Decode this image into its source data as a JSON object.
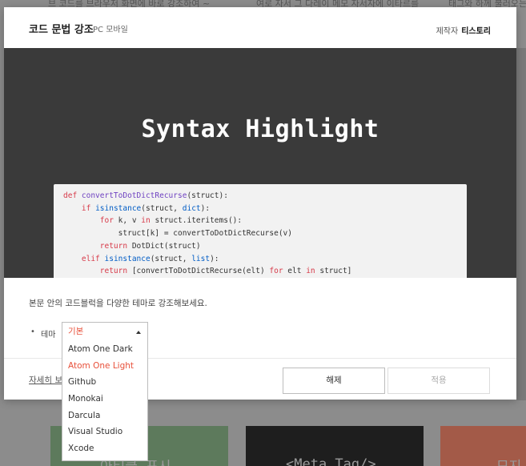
{
  "background": {
    "top_text_left": "브 코드를 브라우저 화면에 바로 강조하여 ~",
    "top_text_mid": "여로 자서 그 다레이 메모 자서자에 이타르를",
    "top_text_right": "태그와 하께 불러오는 ~",
    "card1_label": "아티클 표시",
    "card2_label": "<Meta Tag/>",
    "card3_label": "모지"
  },
  "modal": {
    "title": "코드 문법 강조",
    "subtitle": "PC 모바일",
    "maker_prefix": "제작자",
    "maker_name": "티스토리",
    "preview_title": "Syntax Highlight",
    "description": "본문 안의 코드블럭을 다양한 테마로 강조해보세요.",
    "theme_bullet": "•",
    "theme_label": "테마",
    "detail_link": "자세히 보기",
    "cancel_label": "해제",
    "apply_label": "적용"
  },
  "code": {
    "l1_kw": "def ",
    "l1_fn": "convertToDotDictRecurse",
    "l1_rest": "(struct):",
    "l2_kw": "if ",
    "l2_bi": "isinstance",
    "l2_mid": "(struct, ",
    "l2_bi2": "dict",
    "l2_rest": "):",
    "l3_kw": "for ",
    "l3_mid": "k, v ",
    "l3_kw2": "in ",
    "l3_rest": "struct.iteritems():",
    "l4": "struct[k] = convertToDotDictRecurse(v)",
    "l5_kw": "return ",
    "l5_rest": "DotDict(struct)",
    "l6_kw": "elif ",
    "l6_bi": "isinstance",
    "l6_mid": "(struct, ",
    "l6_bi2": "list",
    "l6_rest": "):",
    "l7_kw": "return ",
    "l7_mid": "[convertToDotDictRecurse(elt) ",
    "l7_kw2": "for ",
    "l7_mid2": "elt ",
    "l7_kw3": "in ",
    "l7_rest": "struct]"
  },
  "dropdown": {
    "selected": "기본",
    "options": [
      "Atom One Dark",
      "Atom One Light",
      "Github",
      "Monokai",
      "Darcula",
      "Visual Studio",
      "Xcode"
    ],
    "highlighted_index": 1
  },
  "colors": {
    "accent": "#e8503a",
    "preview_bg": "#3a3a3a"
  }
}
